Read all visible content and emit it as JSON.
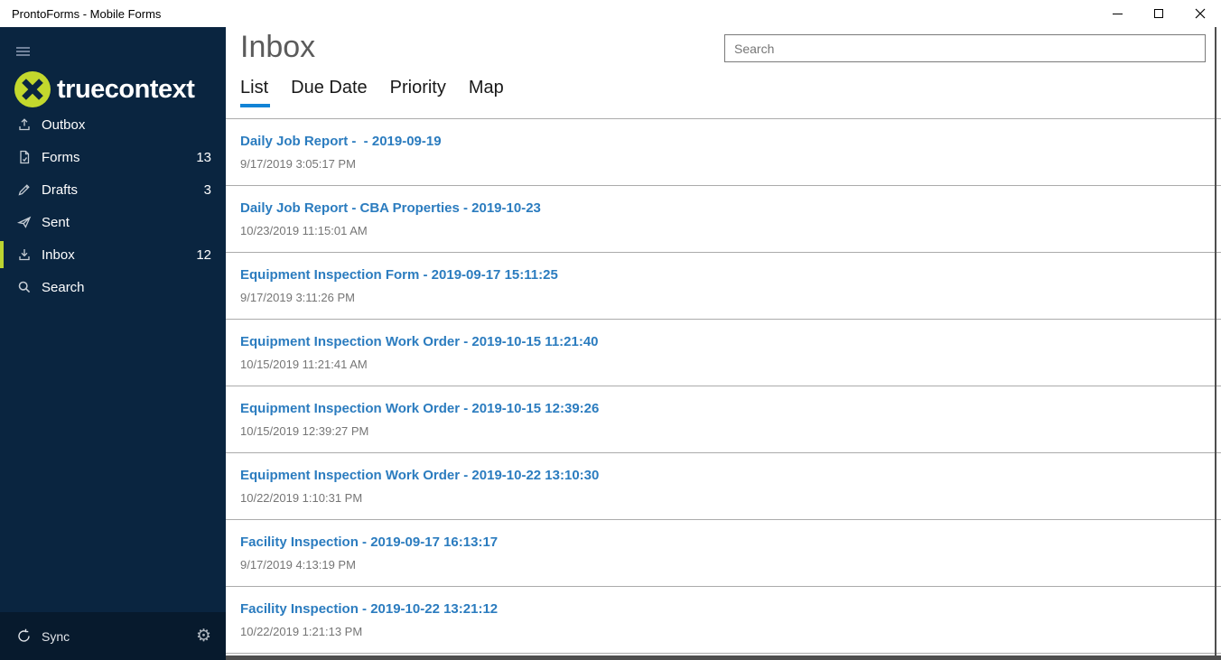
{
  "window": {
    "title": "ProntoForms - Mobile Forms"
  },
  "sidebar": {
    "logo_text": "truecontext",
    "items": [
      {
        "label": "Outbox",
        "icon": "upload-icon",
        "badge": "",
        "active": false
      },
      {
        "label": "Forms",
        "icon": "form-icon",
        "badge": "13",
        "active": false
      },
      {
        "label": "Drafts",
        "icon": "pencil-icon",
        "badge": "3",
        "active": false
      },
      {
        "label": "Sent",
        "icon": "send-icon",
        "badge": "",
        "active": false
      },
      {
        "label": "Inbox",
        "icon": "download-icon",
        "badge": "12",
        "active": true
      },
      {
        "label": "Search",
        "icon": "search-icon",
        "badge": "",
        "active": false
      }
    ],
    "footer": {
      "sync_label": "Sync",
      "sync_icon": "sync-icon",
      "settings_icon": "gear-icon",
      "gear_glyph": "⚙"
    }
  },
  "main": {
    "title": "Inbox",
    "tabs": [
      {
        "label": "List",
        "active": true
      },
      {
        "label": "Due Date",
        "active": false
      },
      {
        "label": "Priority",
        "active": false
      },
      {
        "label": "Map",
        "active": false
      }
    ],
    "search": {
      "placeholder": "Search"
    },
    "items": [
      {
        "title": "Daily Job Report -  - 2019-09-19",
        "timestamp": "9/17/2019 3:05:17 PM"
      },
      {
        "title": "Daily Job Report - CBA Properties - 2019-10-23",
        "timestamp": "10/23/2019 11:15:01 AM"
      },
      {
        "title": "Equipment Inspection Form - 2019-09-17 15:11:25",
        "timestamp": "9/17/2019 3:11:26 PM"
      },
      {
        "title": "Equipment Inspection Work Order - 2019-10-15 11:21:40",
        "timestamp": "10/15/2019 11:21:41 AM"
      },
      {
        "title": "Equipment Inspection Work Order - 2019-10-15 12:39:26",
        "timestamp": "10/15/2019 12:39:27 PM"
      },
      {
        "title": "Equipment Inspection Work Order - 2019-10-22 13:10:30",
        "timestamp": "10/22/2019 1:10:31 PM"
      },
      {
        "title": "Facility Inspection - 2019-09-17 16:13:17",
        "timestamp": "9/17/2019 4:13:19 PM"
      },
      {
        "title": "Facility Inspection - 2019-10-22 13:21:12",
        "timestamp": "10/22/2019 1:21:13 PM"
      }
    ]
  },
  "colors": {
    "sidebar_bg": "#0a2540",
    "sidebar_footer_bg": "#071a2d",
    "accent_green": "#bcd431",
    "logo_green": "#c3d82d",
    "item_title_blue": "#2b7cbf",
    "tab_underline_blue": "#1283d6",
    "divider_gray": "#ababab",
    "timestamp_gray": "#757575",
    "page_title_gray": "#5b5b5b"
  }
}
